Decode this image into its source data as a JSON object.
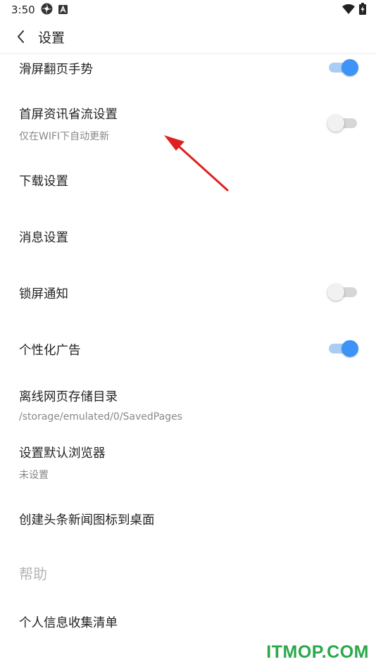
{
  "status_bar": {
    "time": "3:50",
    "left_icons": [
      "settings-wheel-icon",
      "a-badge-icon"
    ],
    "right_icons": [
      "wifi-icon",
      "battery-charging-icon"
    ]
  },
  "app_bar": {
    "back_icon": "chevron-left-icon",
    "title": "设置"
  },
  "settings": [
    {
      "id": "swipe-page",
      "title": "滑屏翻页手势",
      "toggle": true
    },
    {
      "id": "data-saver",
      "title": "首屏资讯省流设置",
      "subtitle": "仅在WIFI下自动更新",
      "toggle": false
    },
    {
      "id": "download",
      "title": "下载设置"
    },
    {
      "id": "message",
      "title": "消息设置"
    },
    {
      "id": "lockscreen",
      "title": "锁屏通知",
      "toggle": false
    },
    {
      "id": "ads",
      "title": "个性化广告",
      "toggle": true
    },
    {
      "id": "offline-dir",
      "title": "离线网页存储目录",
      "subtitle": "/storage/emulated/0/SavedPages"
    },
    {
      "id": "default-browser",
      "title": "设置默认浏览器",
      "subtitle": "未设置"
    },
    {
      "id": "shortcut",
      "title": "创建头条新闻图标到桌面"
    }
  ],
  "help_section": {
    "header": "帮助",
    "items": [
      {
        "id": "personal-info",
        "title": "个人信息收集清单"
      }
    ]
  },
  "annotation": {
    "arrow_color": "#e02020"
  },
  "watermark": "ITMOP.COM",
  "colors": {
    "toggle_on_thumb": "#3d94f6",
    "toggle_on_track": "#a9cdf5",
    "toggle_off_thumb": "#f1f1f1",
    "toggle_off_track": "#d6d6d6",
    "watermark": "#2aa84a"
  }
}
